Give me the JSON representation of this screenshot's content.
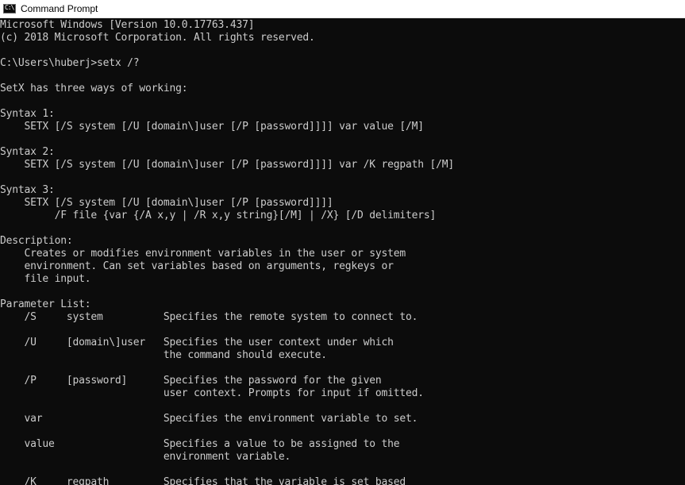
{
  "window": {
    "title": "Command Prompt",
    "icon": "command-prompt-icon"
  },
  "colors": {
    "console_bg": "#0c0c0c",
    "console_fg": "#cccccc",
    "titlebar_bg": "#ffffff"
  },
  "console": {
    "lines": [
      "Microsoft Windows [Version 10.0.17763.437]",
      "(c) 2018 Microsoft Corporation. All rights reserved.",
      "",
      "C:\\Users\\huberj>setx /?",
      "",
      "SetX has three ways of working:",
      "",
      "Syntax 1:",
      "    SETX [/S system [/U [domain\\]user [/P [password]]]] var value [/M]",
      "",
      "Syntax 2:",
      "    SETX [/S system [/U [domain\\]user [/P [password]]]] var /K regpath [/M]",
      "",
      "Syntax 3:",
      "    SETX [/S system [/U [domain\\]user [/P [password]]]]",
      "         /F file {var {/A x,y | /R x,y string}[/M] | /X} [/D delimiters]",
      "",
      "Description:",
      "    Creates or modifies environment variables in the user or system",
      "    environment. Can set variables based on arguments, regkeys or",
      "    file input.",
      "",
      "Parameter List:",
      "    /S     system          Specifies the remote system to connect to.",
      "",
      "    /U     [domain\\]user   Specifies the user context under which",
      "                           the command should execute.",
      "",
      "    /P     [password]      Specifies the password for the given",
      "                           user context. Prompts for input if omitted.",
      "",
      "    var                    Specifies the environment variable to set.",
      "",
      "    value                  Specifies a value to be assigned to the",
      "                           environment variable.",
      "",
      "    /K     regpath         Specifies that the variable is set based"
    ]
  }
}
